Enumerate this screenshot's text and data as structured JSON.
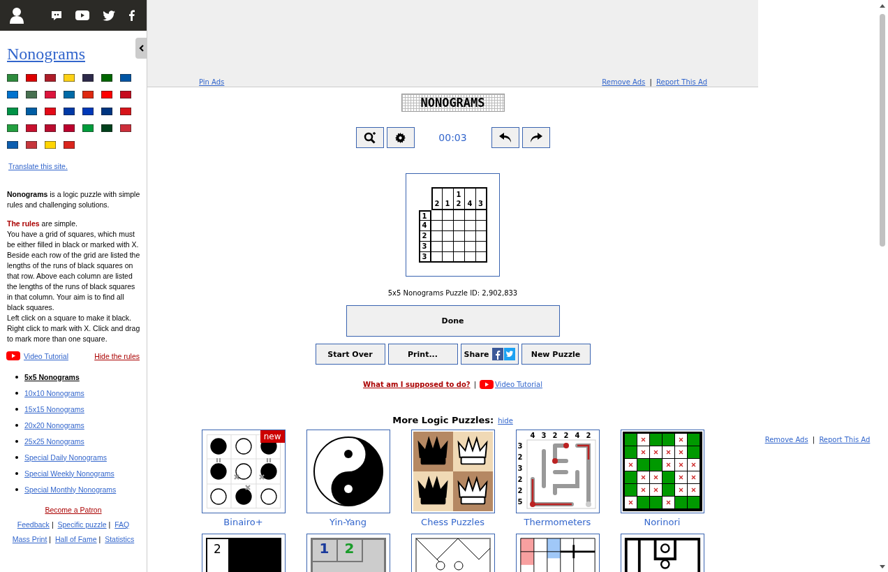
{
  "sidebar": {
    "title": "Nonograms",
    "flags": [
      {
        "color": "#2e8b3d"
      },
      {
        "color": "#dd0000"
      },
      {
        "color": "#ae1c28"
      },
      {
        "color": "#fcd116"
      },
      {
        "color": "#2d2a4a"
      },
      {
        "color": "#006600"
      },
      {
        "color": "#0055a4"
      },
      {
        "color": "#0072ce"
      },
      {
        "color": "#477050"
      },
      {
        "color": "#dc143c"
      },
      {
        "color": "#006aa7"
      },
      {
        "color": "#de2910"
      },
      {
        "color": "#fe0000"
      },
      {
        "color": "#c60b1e"
      },
      {
        "color": "#009246"
      },
      {
        "color": "#005da4"
      },
      {
        "color": "#e30a17"
      },
      {
        "color": "#0039a6"
      },
      {
        "color": "#0038b8"
      },
      {
        "color": "#003580"
      },
      {
        "color": "#d7141a"
      },
      {
        "color": "#239f40"
      },
      {
        "color": "#c8102e"
      },
      {
        "color": "#ba0c2f"
      },
      {
        "color": "#bc002d"
      },
      {
        "color": "#009c3b"
      },
      {
        "color": "#01411c"
      },
      {
        "color": "#cd2e3a"
      },
      {
        "color": "#0d5eaf"
      },
      {
        "color": "#c6363c"
      },
      {
        "color": "#ffd500"
      },
      {
        "color": "#da251d"
      }
    ],
    "translate_link": "Translate this site.",
    "intro": "**Nonograms** is a logic puzzle with simple rules and challenging solutions.",
    "rules_lines": [
      "**The rules** are simple.",
      "You have a grid of squares, which must be either filled in black or marked with X. Beside each row of the grid are listed the lengths of the runs of black squares on that row. Above each column are listed the lengths of the runs of black squares in that column. Your aim is to find all black squares.",
      "Left click on a square to make it black. Right click to mark with X. Click and drag to mark more than one square."
    ],
    "video_link": "Video Tutorial",
    "hide_rules_link": "Hide the rules",
    "puzzle_types": [
      {
        "label": "5x5 Nonograms",
        "selected": true
      },
      {
        "label": "10x10 Nonograms",
        "selected": false
      },
      {
        "label": "15x15 Nonograms",
        "selected": false
      },
      {
        "label": "20x20 Nonograms",
        "selected": false
      },
      {
        "label": "25x25 Nonograms",
        "selected": false
      },
      {
        "label": "Special Daily Nonograms",
        "selected": false
      },
      {
        "label": "Special Weekly Nonograms",
        "selected": false
      },
      {
        "label": "Special Monthly Nonograms",
        "selected": false
      }
    ],
    "patron_link": "Become a Patron",
    "footer_links": [
      [
        "Feedback",
        "Specific puzzle",
        "FAQ"
      ],
      [
        "Mass Print",
        "Hall of Fame",
        "Statistics"
      ]
    ]
  },
  "separator": "|",
  "ads": {
    "pin": "Pin Ads",
    "remove": "Remove Ads",
    "report": "Report This Ad"
  },
  "side_ads": {
    "remove": "Remove Ads",
    "report": "Report This Ad"
  },
  "logo": "NONOGRAMS",
  "timer": "00:03",
  "puzzle": {
    "column_clues": [
      [
        "2"
      ],
      [
        "1"
      ],
      [
        "1",
        "2"
      ],
      [
        "4"
      ],
      [
        "3"
      ]
    ],
    "row_clues": [
      "1",
      "4",
      "2",
      "3",
      "3"
    ]
  },
  "puzzle_id": "5x5 Nonograms Puzzle ID: 2,902,833",
  "done_button": "Done",
  "actions": [
    {
      "label": "Start Over",
      "kind": "plain"
    },
    {
      "label": "Print...",
      "kind": "plain"
    },
    {
      "label": "Share",
      "kind": "share"
    },
    {
      "label": "New Puzzle",
      "kind": "plain"
    }
  ],
  "help_link": "What am I supposed to do?",
  "help_video": "Video Tutorial",
  "more_heading": "More Logic Puzzles:",
  "hide_link": "hide",
  "puzzles": [
    {
      "name": "Binairo+",
      "kind": "binairo",
      "badge": "new"
    },
    {
      "name": "Yin-Yang",
      "kind": "yinyang"
    },
    {
      "name": "Chess Puzzles",
      "kind": "chess"
    },
    {
      "name": "Thermometers",
      "kind": "thermometers",
      "top_clues": [
        "4",
        "3",
        "2",
        "2",
        "4",
        "2"
      ],
      "side_clues": [
        "3",
        "2",
        "3",
        "2",
        "2",
        "5"
      ]
    },
    {
      "name": "Norinori",
      "kind": "norinori"
    },
    {
      "kind": "block",
      "digits": [
        "2"
      ]
    },
    {
      "kind": "digits",
      "digits": [
        "1",
        "2"
      ]
    },
    {
      "kind": "diagonal"
    },
    {
      "kind": "stripes"
    },
    {
      "kind": "walls"
    }
  ]
}
